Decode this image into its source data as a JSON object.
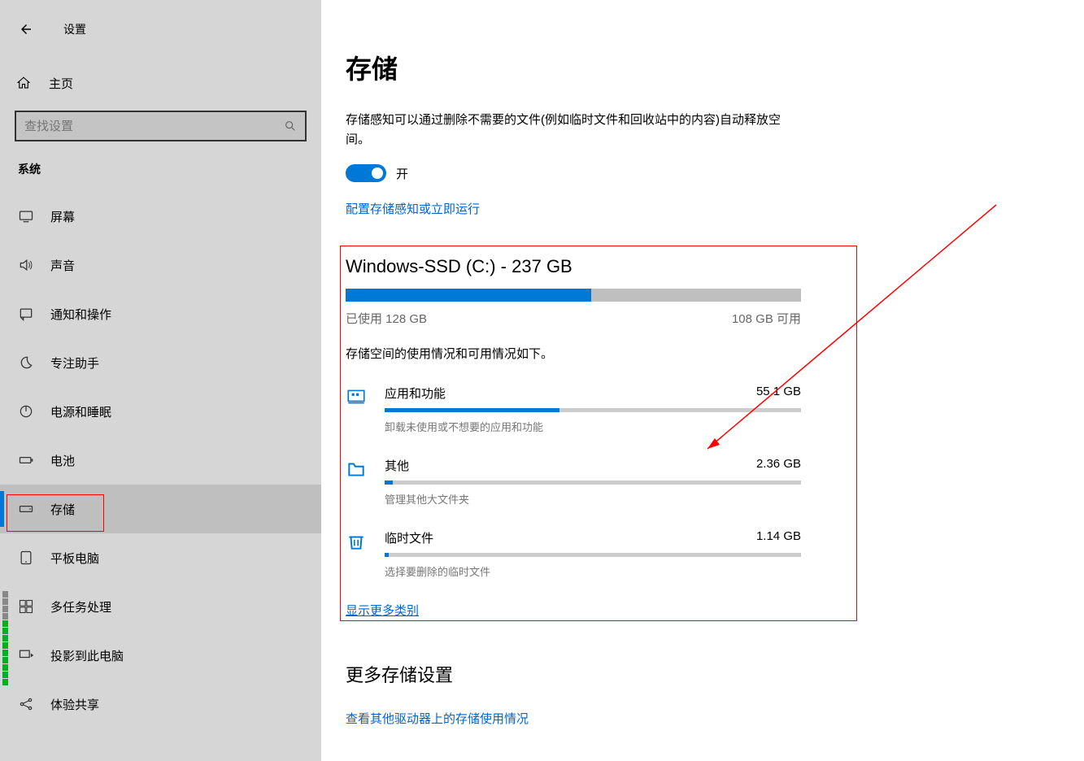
{
  "app_title": "设置",
  "home_label": "主页",
  "search_placeholder": "查找设置",
  "group_title": "系统",
  "nav": [
    {
      "label": "屏幕",
      "icon": "display"
    },
    {
      "label": "声音",
      "icon": "sound"
    },
    {
      "label": "通知和操作",
      "icon": "notification"
    },
    {
      "label": "专注助手",
      "icon": "moon"
    },
    {
      "label": "电源和睡眠",
      "icon": "power"
    },
    {
      "label": "电池",
      "icon": "battery"
    },
    {
      "label": "存储",
      "icon": "storage",
      "selected": true
    },
    {
      "label": "平板电脑",
      "icon": "tablet"
    },
    {
      "label": "多任务处理",
      "icon": "multitask"
    },
    {
      "label": "投影到此电脑",
      "icon": "project"
    },
    {
      "label": "体验共享",
      "icon": "share"
    }
  ],
  "page_title": "存储",
  "page_desc": "存储感知可以通过删除不需要的文件(例如临时文件和回收站中的内容)自动释放空间。",
  "toggle_label": "开",
  "configure_link": "配置存储感知或立即运行",
  "drive": {
    "title": "Windows-SSD (C:) - 237 GB",
    "used_label": "已使用 128 GB",
    "free_label": "108 GB 可用",
    "used_pct": 54,
    "desc": "存储空间的使用情况和可用情况如下。"
  },
  "categories": [
    {
      "name": "应用和功能",
      "size": "55.1 GB",
      "pct": 42,
      "desc": "卸载未使用或不想要的应用和功能",
      "icon": "apps"
    },
    {
      "name": "其他",
      "size": "2.36 GB",
      "pct": 2,
      "desc": "管理其他大文件夹",
      "icon": "folder"
    },
    {
      "name": "临时文件",
      "size": "1.14 GB",
      "pct": 1,
      "desc": "选择要删除的临时文件",
      "icon": "trash"
    }
  ],
  "show_more_link": "显示更多类别",
  "more_settings_title": "更多存储设置",
  "other_drives_link": "查看其他驱动器上的存储使用情况"
}
